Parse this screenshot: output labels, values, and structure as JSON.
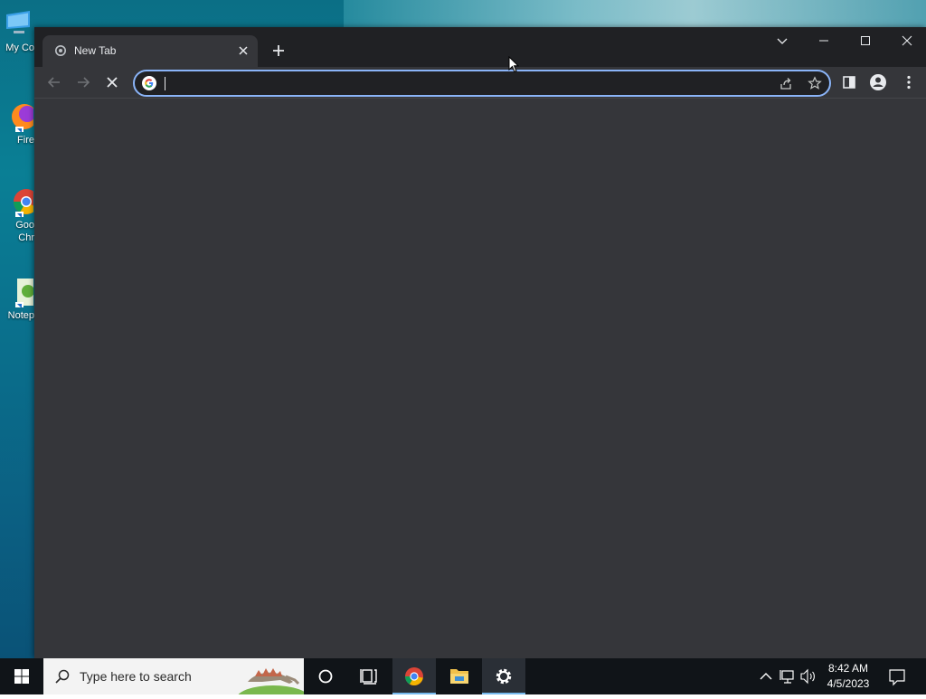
{
  "desktop": {
    "icons": [
      {
        "label": "My Co",
        "icon": "computer-icon"
      },
      {
        "label": "Fire",
        "icon": "firefox-icon"
      },
      {
        "label": "Goo",
        "label2": "Chr",
        "icon": "chrome-icon"
      },
      {
        "label": "Notep",
        "icon": "notepad-icon"
      }
    ]
  },
  "browser": {
    "tab": {
      "title": "New Tab",
      "favicon": "chrome-favicon-icon",
      "close": "close-icon"
    },
    "new_tab_icon": "plus-icon",
    "window_controls": [
      "tab-search-icon",
      "minimize-icon",
      "maximize-icon",
      "close-icon"
    ],
    "toolbar": {
      "back": "back-arrow-icon",
      "forward": "forward-arrow-icon",
      "stop": "stop-loading-icon",
      "omnibox": {
        "value": "",
        "placeholder": "",
        "engine_icon": "google-g-icon"
      },
      "share": "share-icon",
      "bookmark": "star-icon",
      "side_panel": "side-panel-icon",
      "profile": "profile-icon",
      "menu": "more-vert-icon"
    },
    "theme": {
      "frame": "#202124",
      "toolbar": "#35363a",
      "accent": "#8ab4f8",
      "text": "#e8eaed"
    }
  },
  "taskbar": {
    "start_icon": "windows-logo-icon",
    "search": {
      "placeholder": "Type here to search",
      "icon": "search-icon"
    },
    "items": [
      {
        "name": "cortana",
        "icon": "cortana-circle-icon",
        "active": false
      },
      {
        "name": "task-view",
        "icon": "task-view-icon",
        "active": false
      },
      {
        "name": "chrome",
        "icon": "chrome-icon",
        "active": true
      },
      {
        "name": "file-explorer",
        "icon": "folder-icon",
        "active": false
      },
      {
        "name": "settings",
        "icon": "gear-icon",
        "active": true
      }
    ],
    "tray": {
      "icons": [
        "chevron-up-icon",
        "network-icon",
        "volume-icon"
      ],
      "time": "8:42 AM",
      "date": "4/5/2023",
      "notifications_icon": "notification-icon"
    },
    "accent": "#76b9ed"
  }
}
